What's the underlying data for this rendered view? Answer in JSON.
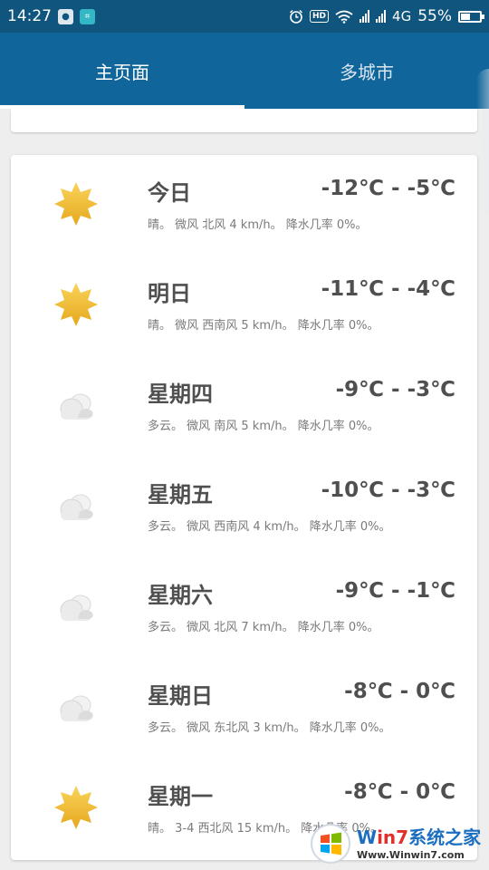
{
  "status_bar": {
    "time": "14:27",
    "hd": "HD",
    "network": "4G",
    "battery_text": "55%",
    "battery_level": 0.55,
    "icons": [
      "notification-icon",
      "scan-icon",
      "alarm-icon",
      "wifi-icon",
      "signal-icon",
      "battery-icon"
    ]
  },
  "tabs": [
    {
      "label": "主页面",
      "active": true
    },
    {
      "label": "多城市",
      "active": false
    }
  ],
  "forecast": [
    {
      "day": "今日",
      "temp": "-12℃ - -5℃",
      "desc": "晴。 微风 北风 4 km/h。 降水几率 0%。",
      "icon": "sun-icon"
    },
    {
      "day": "明日",
      "temp": "-11℃ - -4℃",
      "desc": "晴。 微风 西南风 5 km/h。 降水几率 0%。",
      "icon": "sun-icon"
    },
    {
      "day": "星期四",
      "temp": "-9℃ - -3℃",
      "desc": "多云。 微风 南风 5 km/h。 降水几率 0%。",
      "icon": "cloud-icon"
    },
    {
      "day": "星期五",
      "temp": "-10℃ - -3℃",
      "desc": "多云。 微风 西南风 4 km/h。 降水几率 0%。",
      "icon": "cloud-icon"
    },
    {
      "day": "星期六",
      "temp": "-9℃ - -1℃",
      "desc": "多云。 微风 北风 7 km/h。 降水几率 0%。",
      "icon": "cloud-icon"
    },
    {
      "day": "星期日",
      "temp": "-8℃ - 0℃",
      "desc": "多云。 微风 东北风 3 km/h。 降水几率 0%。",
      "icon": "cloud-icon"
    },
    {
      "day": "星期一",
      "temp": "-8℃ - 0℃",
      "desc": "晴。 3-4 西北风 15 km/h。 降水几率 0%。",
      "icon": "sun-icon"
    }
  ],
  "watermark": {
    "brand_pre": "W",
    "brand_mid": "in7",
    "brand_post": "系统之家",
    "url": "Www.Winwin7.com"
  },
  "colors": {
    "status_bar": "#10557d",
    "tab_bar": "#10669a",
    "sun": "#f2b92a",
    "cloud": "#e6e6e6"
  }
}
